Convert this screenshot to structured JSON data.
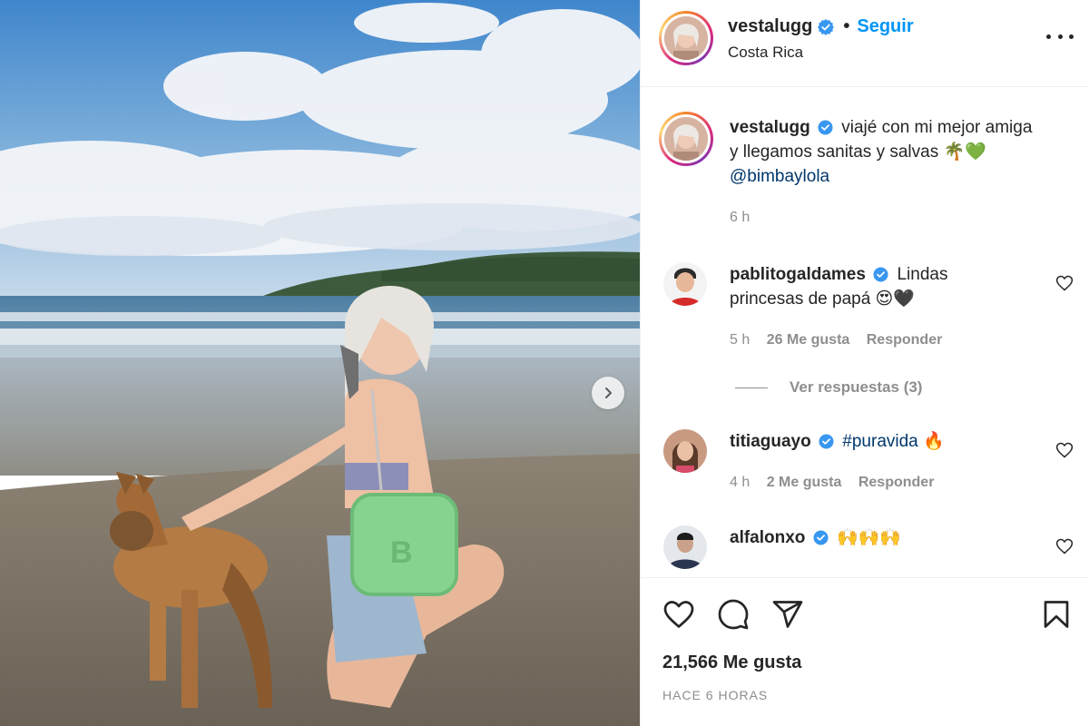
{
  "post": {
    "username": "vestalugg",
    "follow_label": "Seguir",
    "location": "Costa Rica",
    "separator": "•"
  },
  "caption": {
    "username": "vestalugg",
    "line1": "viajé con mi mejor amiga",
    "line2": "y llegamos sanitas y salvas 🌴💚",
    "mention": "@bimbaylola",
    "time": "6 h"
  },
  "comments": [
    {
      "username": "pablitogaldames",
      "text_line1": "Lindas",
      "text_line2": "princesas de papá 😍🖤",
      "time": "5 h",
      "likes": "26 Me gusta",
      "reply_label": "Responder"
    },
    {
      "username": "titiaguayo",
      "text": "#puravida 🔥",
      "time": "4 h",
      "likes": "2 Me gusta",
      "reply_label": "Responder"
    },
    {
      "username": "alfalonxo",
      "text": "🙌🙌🙌"
    }
  ],
  "view_replies_label": "Ver respuestas (3)",
  "likes_count": "21,566 Me gusta",
  "time_ago": "HACE 6 HORAS",
  "icons": [
    "verified-badge-icon",
    "more-options-icon",
    "heart-icon",
    "comment-icon",
    "share-icon",
    "bookmark-icon",
    "chevron-right-icon"
  ],
  "colors": {
    "follow": "#0095f6",
    "verified": "#3897f0",
    "muted": "#8e8e8e"
  }
}
